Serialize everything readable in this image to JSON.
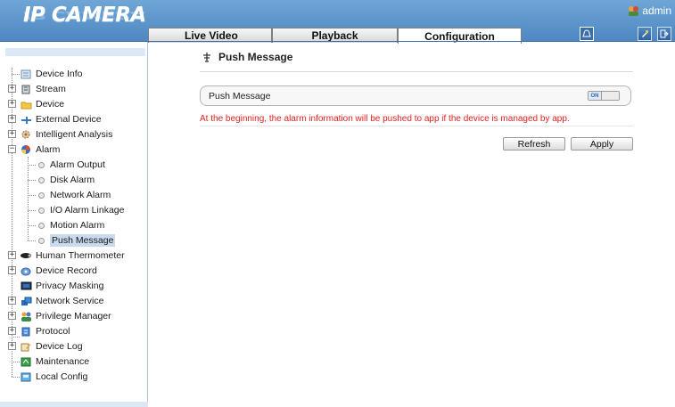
{
  "header": {
    "logo": "IP CAMERA",
    "user": "admin",
    "tabs": [
      {
        "label": "Live Video"
      },
      {
        "label": "Playback"
      },
      {
        "label": "Configuration"
      }
    ],
    "icons": {
      "notify": "bell-icon",
      "reset": "reset-icon",
      "logout": "logout-icon"
    }
  },
  "sidebar": {
    "items": [
      {
        "label": "Device Info",
        "icon": "device-info-icon"
      },
      {
        "label": "Stream",
        "icon": "stream-icon"
      },
      {
        "label": "Device",
        "icon": "folder-icon"
      },
      {
        "label": "External Device",
        "icon": "external-device-icon"
      },
      {
        "label": "Intelligent Analysis",
        "icon": "gear-icon"
      },
      {
        "label": "Alarm",
        "icon": "alarm-icon"
      },
      {
        "label": "Alarm Output"
      },
      {
        "label": "Disk Alarm"
      },
      {
        "label": "Network Alarm"
      },
      {
        "label": "I/O Alarm Linkage"
      },
      {
        "label": "Motion Alarm"
      },
      {
        "label": "Push Message"
      },
      {
        "label": "Human Thermometer",
        "icon": "thermometer-icon"
      },
      {
        "label": "Device Record",
        "icon": "record-icon"
      },
      {
        "label": "Privacy Masking",
        "icon": "monitor-icon"
      },
      {
        "label": "Network Service",
        "icon": "network-icon"
      },
      {
        "label": "Privilege Manager",
        "icon": "users-icon"
      },
      {
        "label": "Protocol",
        "icon": "protocol-icon"
      },
      {
        "label": "Device Log",
        "icon": "log-icon"
      },
      {
        "label": "Maintenance",
        "icon": "maintenance-icon"
      },
      {
        "label": "Local Config",
        "icon": "local-config-icon"
      }
    ]
  },
  "main": {
    "title": "Push Message",
    "push_label": "Push Message",
    "toggle_state": "ON",
    "note": "At the beginning, the alarm information will be pushed to app if the device is managed by app.",
    "refresh_label": "Refresh",
    "apply_label": "Apply"
  },
  "colors": {
    "header": "#5b93cb",
    "note": "#e02020",
    "selection": "#c9d9ee"
  }
}
